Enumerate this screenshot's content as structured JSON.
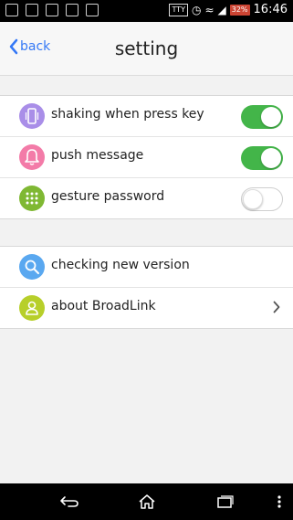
{
  "status_bar": {
    "battery": "32%",
    "time": "16:46",
    "carrier_box": "TTY"
  },
  "header": {
    "back_label": "back",
    "title": "setting"
  },
  "settings_group": {
    "items": [
      {
        "label": "shaking when press key",
        "icon": "phone-vibrate-icon",
        "icon_color": "#a98ee8",
        "toggle": "on"
      },
      {
        "label": "push message",
        "icon": "bell-icon",
        "icon_color": "#f37ba8",
        "toggle": "on"
      },
      {
        "label": "gesture password",
        "icon": "keypad-icon",
        "icon_color": "#7fb833",
        "toggle": "off"
      }
    ]
  },
  "about_group": {
    "items": [
      {
        "label": "checking new version",
        "icon": "search-icon",
        "icon_color": "#5aa8f0"
      },
      {
        "label": "about BroadLink",
        "icon": "user-icon",
        "icon_color": "#b7cf2a"
      }
    ]
  },
  "colors": {
    "accent": "#3478f6",
    "toggle_on": "#43b549"
  }
}
